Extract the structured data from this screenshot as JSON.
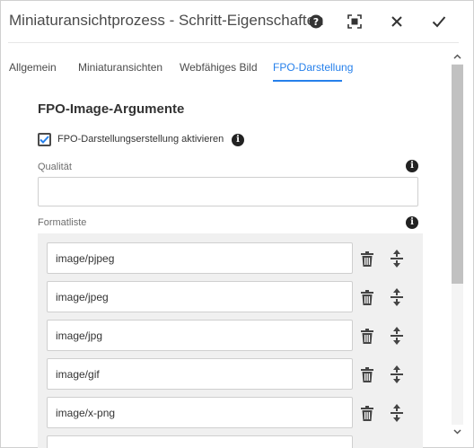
{
  "window": {
    "title": "Miniaturansichtprozess - Schritt-Eigenschaften",
    "icons": {
      "help": "help-circle-icon",
      "fullscreen": "fullscreen-icon",
      "close": "close-icon",
      "done": "checkmark-icon"
    }
  },
  "tabs": [
    {
      "label": "Allgemein",
      "active": false
    },
    {
      "label": "Miniaturansichten",
      "active": false
    },
    {
      "label": "Webfähiges Bild",
      "active": false
    },
    {
      "label": "FPO-Darstellung",
      "active": true
    }
  ],
  "section": {
    "title": "FPO-Image-Argumente",
    "checkbox": {
      "label": "FPO-Darstellungserstellung aktivieren",
      "checked": true
    },
    "quality": {
      "label": "Qualität",
      "value": ""
    },
    "format_list": {
      "label": "Formatliste",
      "items": [
        "image/pjpeg",
        "image/jpeg",
        "image/jpg",
        "image/gif",
        "image/x-png"
      ]
    }
  },
  "colors": {
    "accent": "#2680eb",
    "text": "#4b4b4b",
    "multifield_bg": "#f0f0f0"
  }
}
